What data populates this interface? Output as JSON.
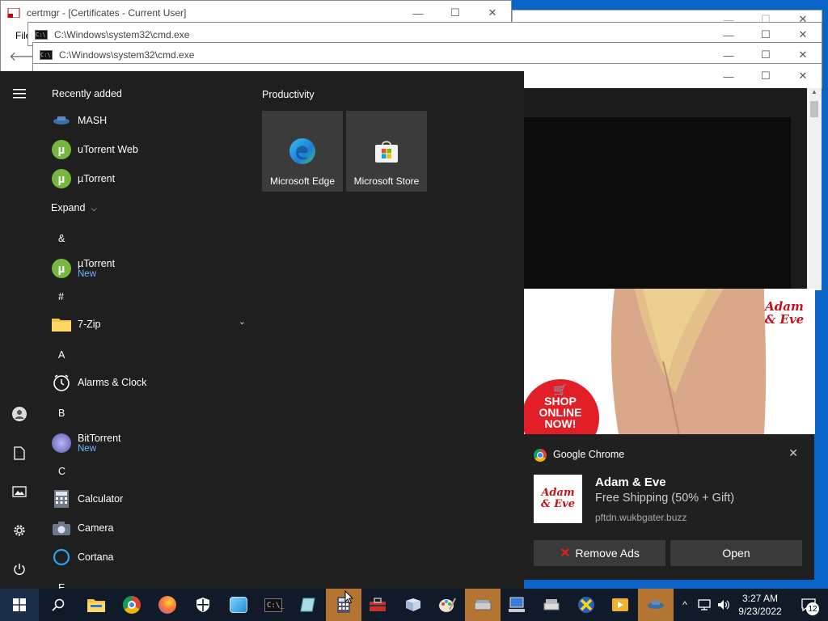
{
  "windows": {
    "certmgr": {
      "title": "certmgr - [Certificates - Current User]",
      "menu_first": "File"
    },
    "cmd1": {
      "title": "C:\\Windows\\system32\\cmd.exe"
    },
    "cmd2": {
      "title": "C:\\Windows\\system32\\cmd.exe"
    }
  },
  "start_menu": {
    "recently_added_heading": "Recently added",
    "recent_apps": [
      {
        "label": "MASH"
      },
      {
        "label": "uTorrent Web"
      },
      {
        "label": "µTorrent"
      }
    ],
    "expand_label": "Expand",
    "groups": [
      {
        "letter": "&",
        "apps": [
          {
            "label": "µTorrent",
            "sub": "New"
          }
        ]
      },
      {
        "letter": "#",
        "apps": [
          {
            "label": "7-Zip"
          }
        ]
      },
      {
        "letter": "A",
        "apps": [
          {
            "label": "Alarms & Clock"
          }
        ]
      },
      {
        "letter": "B",
        "apps": [
          {
            "label": "BitTorrent",
            "sub": "New"
          }
        ]
      },
      {
        "letter": "C",
        "apps": [
          {
            "label": "Calculator"
          },
          {
            "label": "Camera"
          },
          {
            "label": "Cortana"
          }
        ]
      },
      {
        "letter": "E",
        "apps": []
      }
    ],
    "tiles_heading": "Productivity",
    "tiles": [
      {
        "label": "Microsoft Edge",
        "icon": "edge-icon"
      },
      {
        "label": "Microsoft Store",
        "icon": "store-icon"
      }
    ]
  },
  "ad": {
    "brand_line1": "Adam",
    "brand_line2": "& Eve",
    "badge_line1": "SHOP",
    "badge_line2": "ONLINE",
    "badge_line3": "NOW!"
  },
  "notification": {
    "app_name": "Google Chrome",
    "title": "Adam & Eve",
    "message": "Free Shipping (50% + Gift)",
    "source": "pftdn.wukbgater.buzz",
    "remove_button": "Remove Ads",
    "open_button": "Open"
  },
  "taskbar": {
    "time": "3:27 AM",
    "date": "9/23/2022",
    "notification_count": "12"
  },
  "colors": {
    "start_bg": "#1f1f1f",
    "taskbar_bg": "#101a28",
    "active_taskbar": "#b57532",
    "accent_link": "#6eb4ff",
    "desktop": "#0a64c8"
  }
}
